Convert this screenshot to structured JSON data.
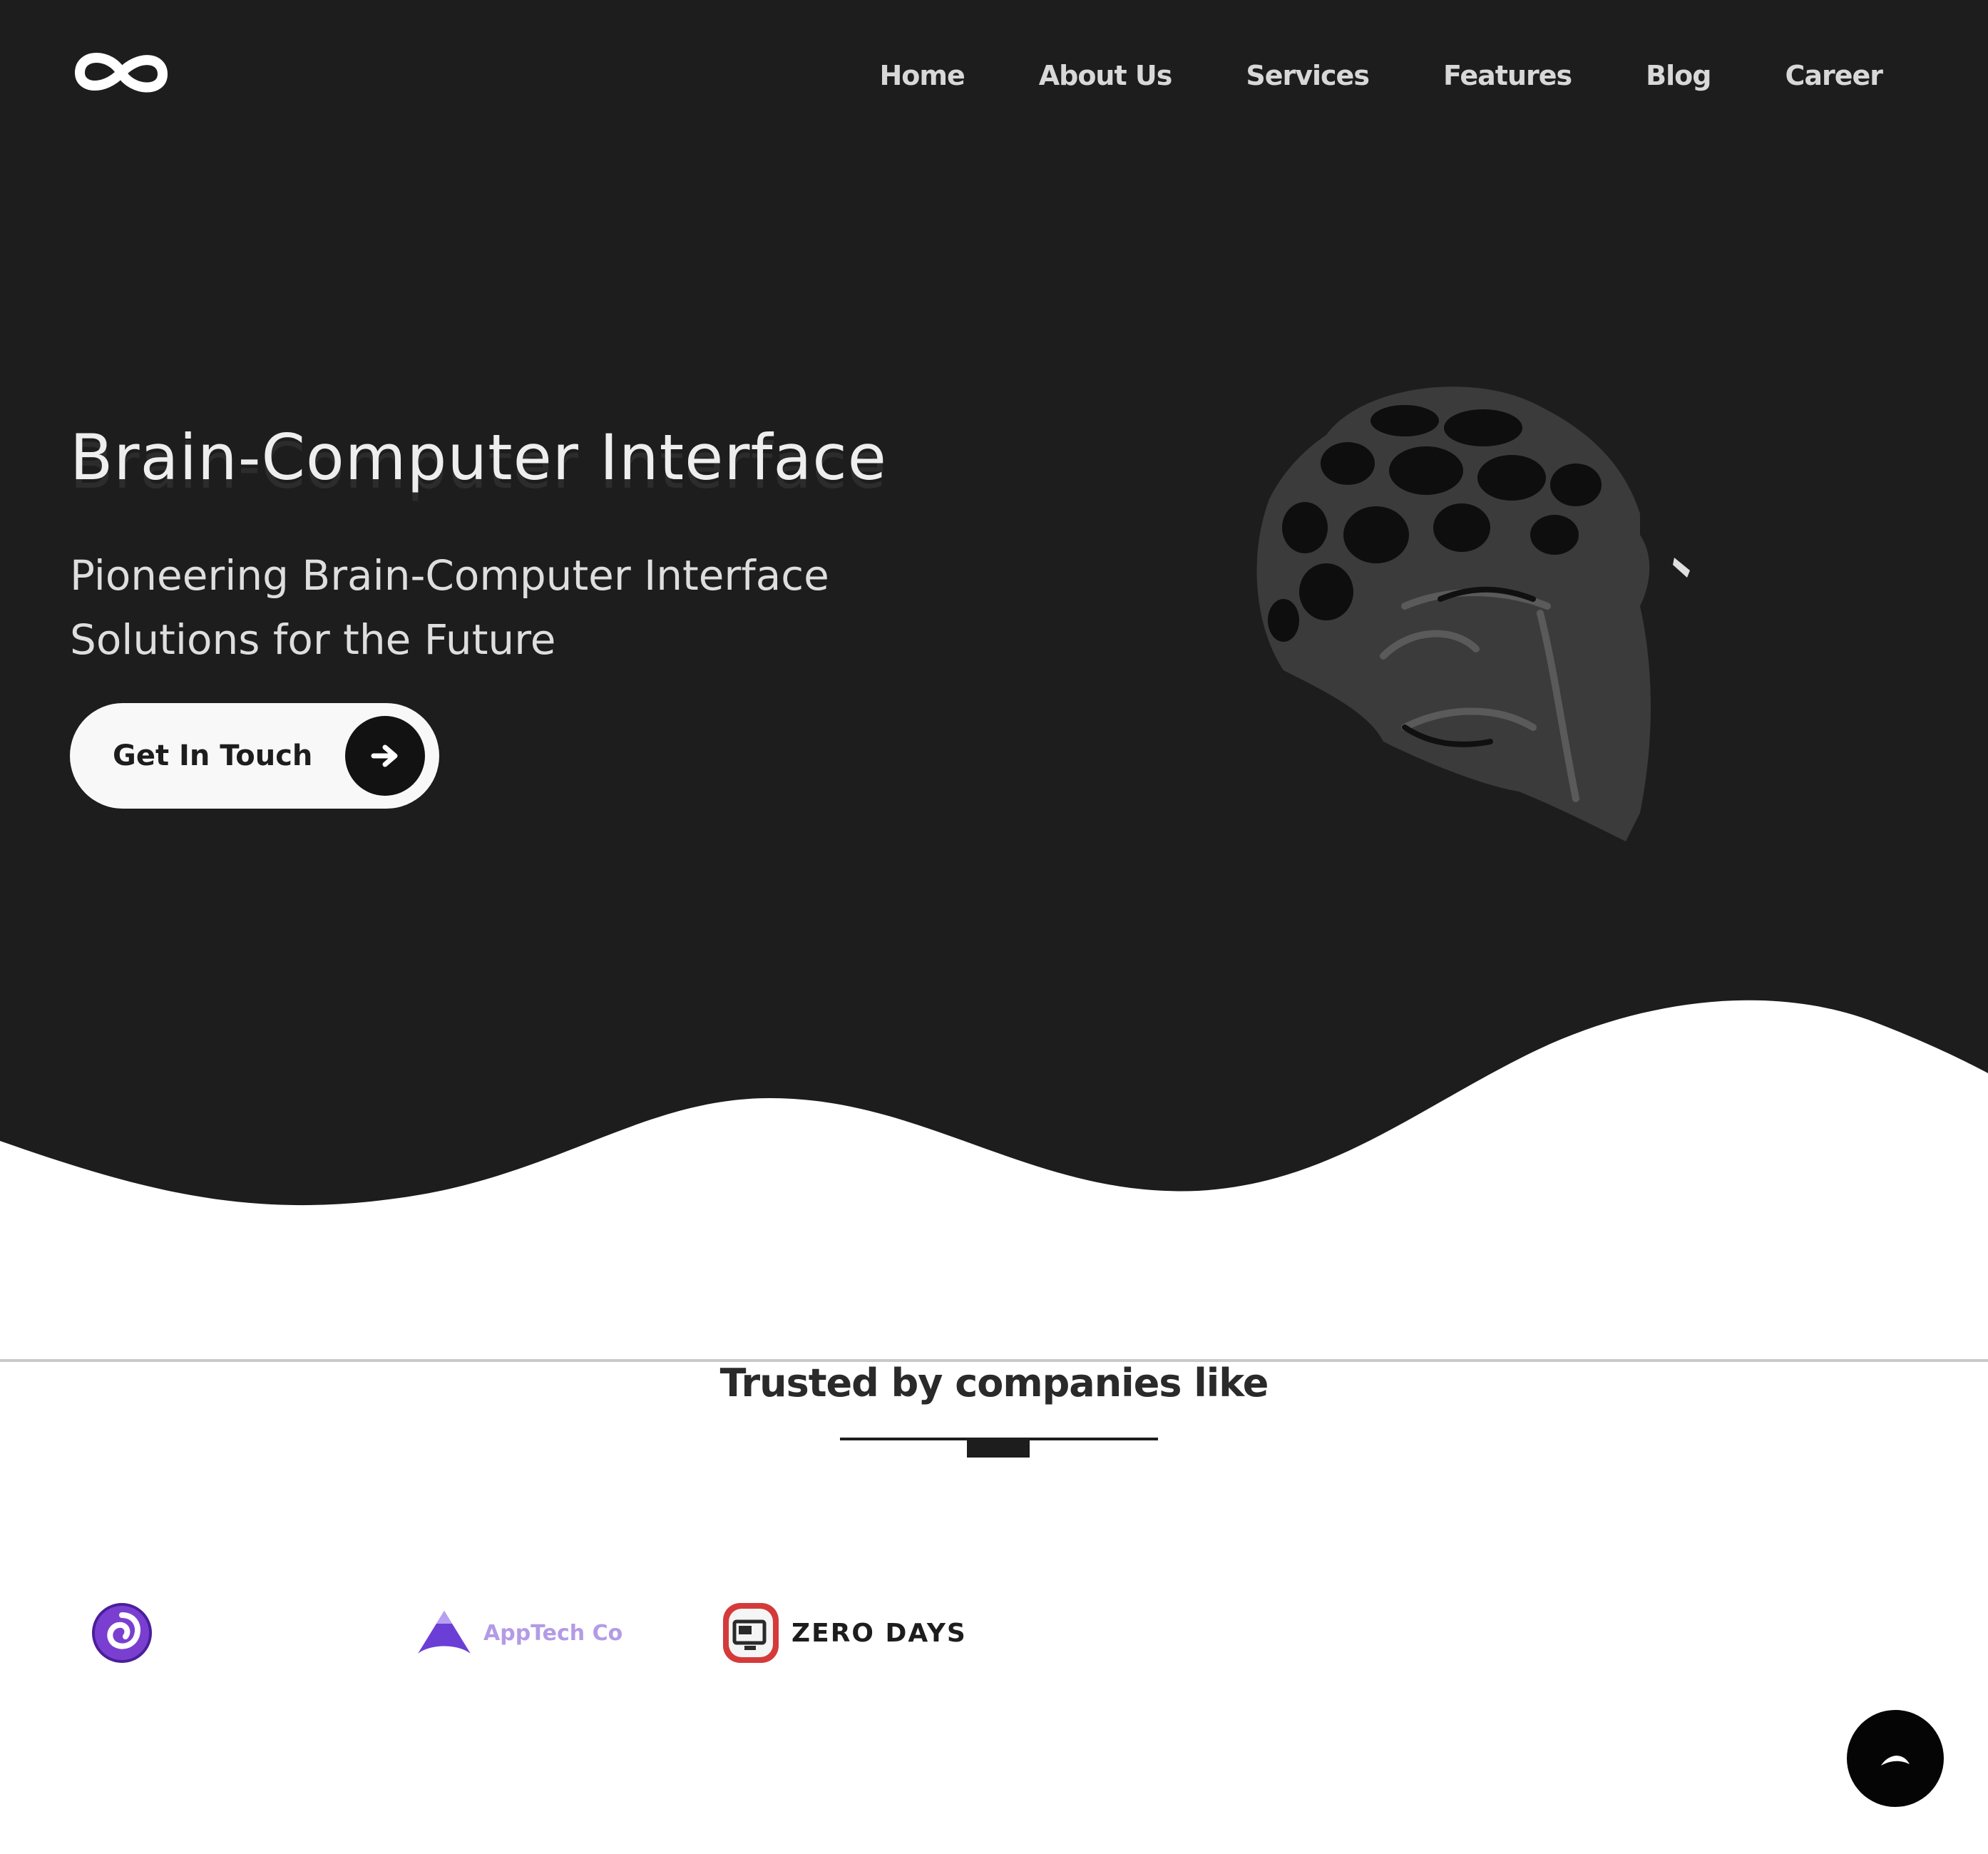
{
  "colors": {
    "hero_background": "#1d1d1e",
    "nav_text": "#d8d8d8",
    "cta_background": "#f8f8f8",
    "accent_purple": "#7a3fd1",
    "zero_days_red": "#d53a3a"
  },
  "header": {
    "logo_icon": "infinity-logo-icon",
    "nav": [
      "Home",
      "About Us",
      "Services",
      "Features",
      "Blog",
      "Career"
    ]
  },
  "hero": {
    "title": "Brain-Computer Interface",
    "subtitle": "Pioneering Brain-Computer Interface Solutions for the Future",
    "cta_label": "Get In Touch",
    "cta_icon": "arrow-right-icon",
    "illustration": "wireframe-head-icon"
  },
  "trusted": {
    "title": "Trusted by companies like",
    "brands": [
      {
        "name": "",
        "icon": "spiral-logo-icon"
      },
      {
        "name": "AppTech Co",
        "icon": "triangle-logo-icon"
      },
      {
        "name": "ZERO DAYS",
        "icon": "monitor-logo-icon"
      }
    ]
  },
  "scroll_top": {
    "icon": "chevron-up-icon"
  }
}
